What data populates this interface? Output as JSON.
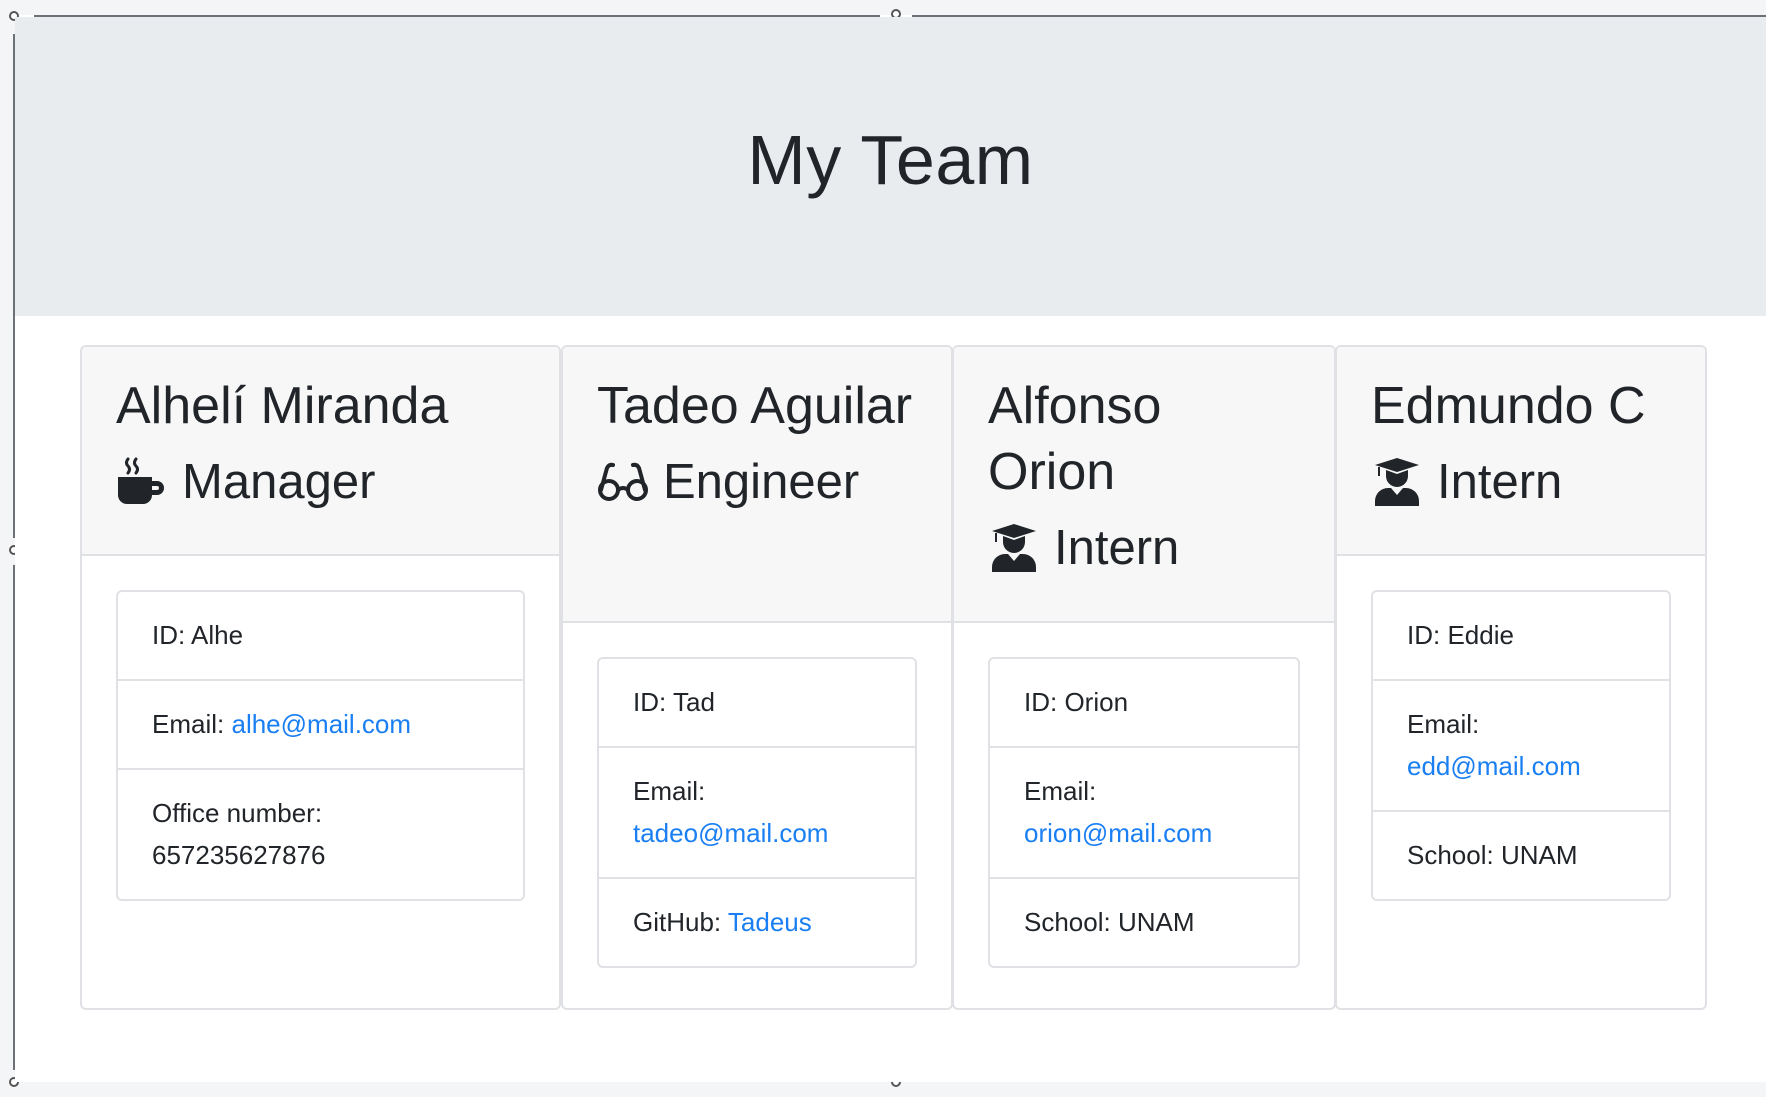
{
  "header": {
    "title": "My Team"
  },
  "employees": [
    {
      "name": "Alhelí Miranda",
      "role": "Manager",
      "role_icon": "coffee-mug-icon",
      "id_label": "ID: Alhe",
      "email_label": "Email:",
      "email": "alhe@mail.com",
      "extra_label": "Office number:",
      "extra_value": "657235627876"
    },
    {
      "name": "Tadeo Aguilar",
      "role": "Engineer",
      "role_icon": "glasses-icon",
      "id_label": "ID: Tad",
      "email_label": "Email:",
      "email": "tadeo@mail.com",
      "extra_label": "GitHub:",
      "extra_value": "Tadeus"
    },
    {
      "name": "Alfonso Orion",
      "role": "Intern",
      "role_icon": "graduate-icon",
      "id_label": "ID: Orion",
      "email_label": "Email:",
      "email": "orion@mail.com",
      "extra_label": "School: UNAM"
    },
    {
      "name": "Edmundo C",
      "role": "Intern",
      "role_icon": "graduate-icon",
      "id_label": "ID: Eddie",
      "email_label": "Email:",
      "email": "edd@mail.com",
      "extra_label": "School: UNAM"
    }
  ],
  "colors": {
    "jumbotron_bg": "#e9ecef",
    "link": "#1a7ff2",
    "card_header_bg": "#f7f7f7"
  }
}
